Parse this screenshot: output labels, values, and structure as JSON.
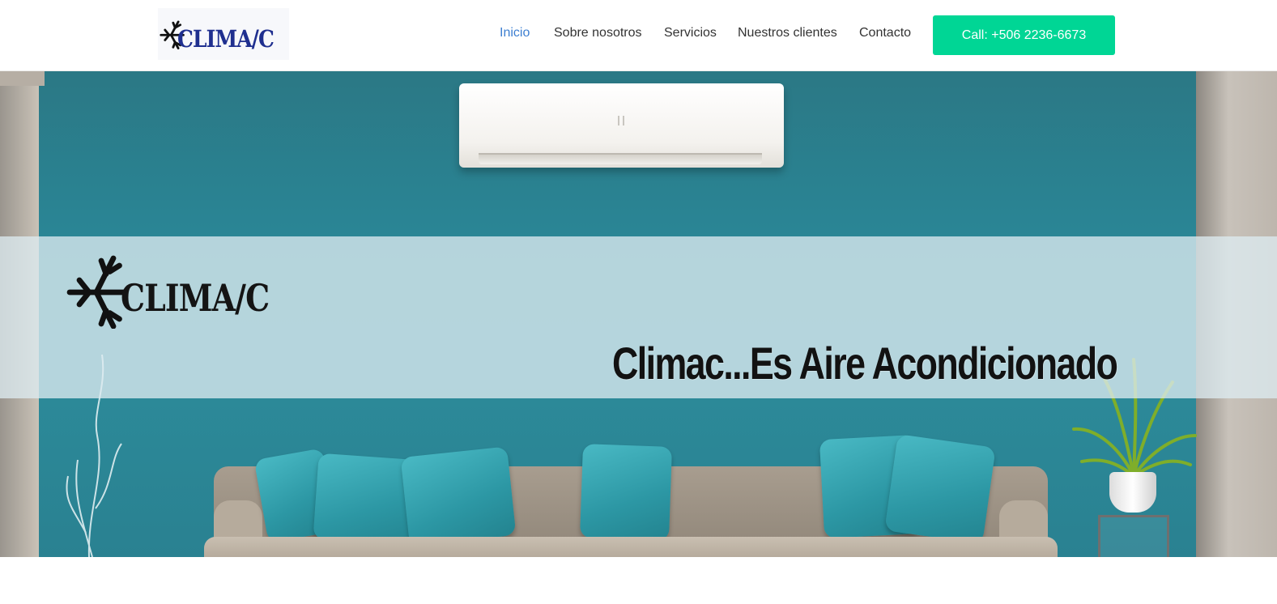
{
  "header": {
    "logo_text": "CLIMA/C",
    "nav": [
      {
        "label": "Inicio",
        "active": true
      },
      {
        "label": "Sobre nosotros",
        "active": false
      },
      {
        "label": "Servicios",
        "active": false
      },
      {
        "label": "Nuestros clientes",
        "active": false
      },
      {
        "label": "Contacto",
        "active": false
      }
    ],
    "call_button": "Call: +506 2236-6673"
  },
  "hero": {
    "logo_text": "CLIMA/C",
    "slogan": "Climac...Es Aire Acondicionado"
  },
  "colors": {
    "accent_button": "#00d695",
    "nav_active": "#3d7fd1",
    "nav_text": "#333333",
    "logo_blue": "#1f2f8f",
    "wall_teal": "#2a8696"
  }
}
